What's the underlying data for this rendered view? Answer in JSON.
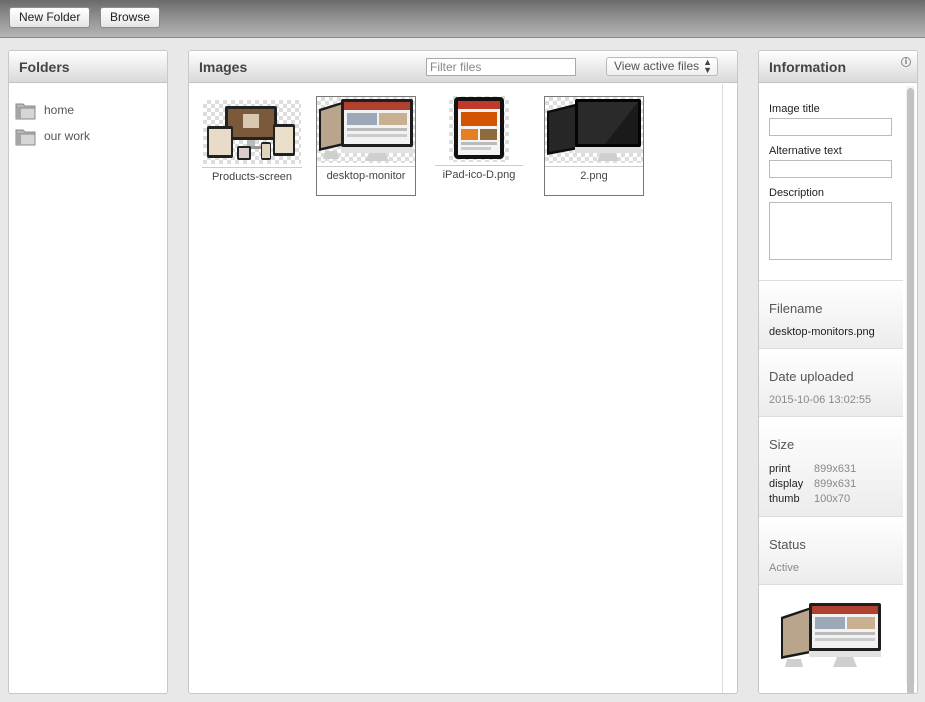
{
  "toolbar": {
    "new_folder": "New Folder",
    "browse": "Browse"
  },
  "folders": {
    "title": "Folders",
    "items": [
      {
        "label": "home"
      },
      {
        "label": "our work"
      }
    ]
  },
  "images": {
    "title": "Images",
    "filter_placeholder": "Filter files",
    "view_select": "View active files",
    "files": [
      {
        "name": "Products-screen",
        "icon": "devices-mockup",
        "selected": false
      },
      {
        "name": "desktop-monitor",
        "icon": "desktop-monitors",
        "selected": true
      },
      {
        "name": "iPad-ico-D.png",
        "icon": "tablet",
        "selected": false
      },
      {
        "name": "2.png",
        "icon": "dark-monitors",
        "selected": true
      }
    ]
  },
  "info": {
    "title": "Information",
    "image_title_label": "Image title",
    "alt_text_label": "Alternative text",
    "description_label": "Description",
    "filename_label": "Filename",
    "filename": "desktop-monitors.png",
    "date_label": "Date uploaded",
    "date": "2015-10-06 13:02:55",
    "size_label": "Size",
    "sizes": [
      {
        "name": "print",
        "value": "899x631"
      },
      {
        "name": "display",
        "value": "899x631"
      },
      {
        "name": "thumb",
        "value": "100x70"
      }
    ],
    "status_label": "Status",
    "status": "Active"
  },
  "colors": {
    "toolbar": "#8a8a8a",
    "panel_border": "#c8c8c8",
    "folder_icon": "#9a9a9a"
  }
}
